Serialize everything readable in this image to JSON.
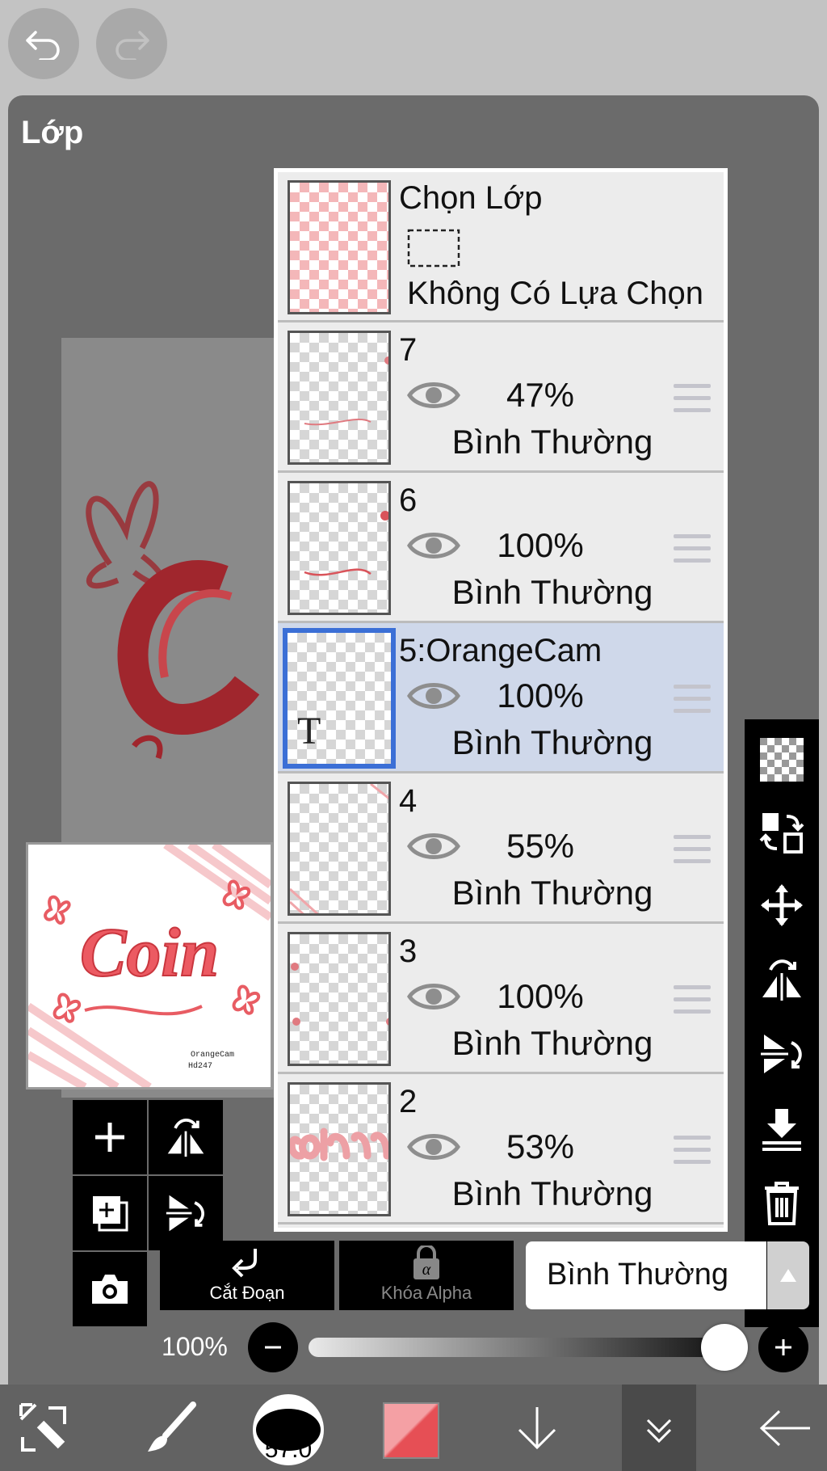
{
  "panel": {
    "title": "Lớp"
  },
  "selection_layer": {
    "title": "Chọn Lớp",
    "status": "Không Có Lựa Chọn"
  },
  "layers": [
    {
      "name": "7",
      "opacity": "47%",
      "blend": "Bình Thường",
      "selected": false
    },
    {
      "name": "6",
      "opacity": "100%",
      "blend": "Bình Thường",
      "selected": false
    },
    {
      "name": "5:OrangeCam",
      "opacity": "100%",
      "blend": "Bình Thường",
      "selected": true
    },
    {
      "name": "4",
      "opacity": "55%",
      "blend": "Bình Thường",
      "selected": false
    },
    {
      "name": "3",
      "opacity": "100%",
      "blend": "Bình Thường",
      "selected": false
    },
    {
      "name": "2",
      "opacity": "53%",
      "blend": "Bình Thường",
      "selected": false
    }
  ],
  "preview": {
    "art_text": "Coin",
    "signature_1": "OrangeCam",
    "signature_2": "Hd247"
  },
  "controls": {
    "clipping_label": "Cắt Đoạn",
    "alpha_lock_label": "Khóa Alpha",
    "blend_mode": "Bình Thường",
    "opacity_label": "100%",
    "opacity_value": 1.0
  },
  "toolbar": {
    "brush_size": "57.0",
    "color": "#e64f55"
  }
}
